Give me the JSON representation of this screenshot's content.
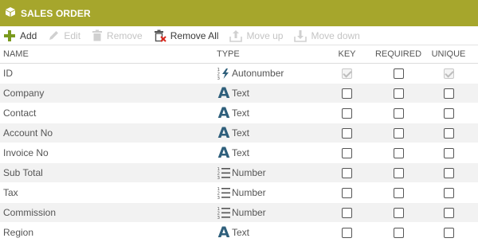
{
  "header": {
    "title": "SALES ORDER",
    "icon": "cube-icon"
  },
  "toolbar": {
    "add": "Add",
    "edit": "Edit",
    "remove": "Remove",
    "remove_all": "Remove All",
    "move_up": "Move up",
    "move_down": "Move down"
  },
  "columns": {
    "name": "NAME",
    "type": "TYPE",
    "key": "KEY",
    "required": "REQUIRED",
    "unique": "UNIQUE"
  },
  "fields": [
    {
      "name": "ID",
      "type": "Autonumber",
      "key": true,
      "key_disabled": true,
      "required": false,
      "unique": true,
      "unique_disabled": true
    },
    {
      "name": "Company",
      "type": "Text",
      "key": false,
      "required": false,
      "unique": false
    },
    {
      "name": "Contact",
      "type": "Text",
      "key": false,
      "required": false,
      "unique": false
    },
    {
      "name": "Account No",
      "type": "Text",
      "key": false,
      "required": false,
      "unique": false
    },
    {
      "name": "Invoice No",
      "type": "Text",
      "key": false,
      "required": false,
      "unique": false
    },
    {
      "name": "Sub Total",
      "type": "Number",
      "key": false,
      "required": false,
      "unique": false
    },
    {
      "name": "Tax",
      "type": "Number",
      "key": false,
      "required": false,
      "unique": false
    },
    {
      "name": "Commission",
      "type": "Number",
      "key": false,
      "required": false,
      "unique": false
    },
    {
      "name": "Region",
      "type": "Text",
      "key": false,
      "required": false,
      "unique": false
    }
  ],
  "colors": {
    "header_bg": "#a6a62c",
    "add_green": "#7a9a1e",
    "text_type_blue": "#2f5f7b",
    "alt_row": "#f2f2f2"
  }
}
